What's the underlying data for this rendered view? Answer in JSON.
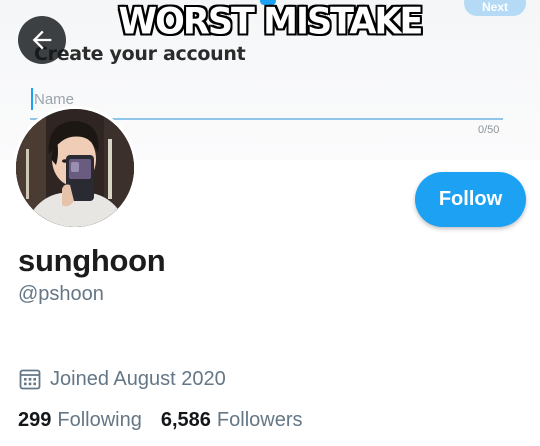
{
  "banner": {
    "caption": "WORST MISTAKE",
    "next_label": "Next",
    "title": "Create your account",
    "name_placeholder": "Name",
    "char_counter": "0/50"
  },
  "profile": {
    "display_name": "sunghoon",
    "handle": "@pshoon",
    "joined": "Joined August 2020",
    "follow_label": "Follow"
  },
  "stats": {
    "following_count": "299",
    "following_label": "Following",
    "followers_count": "6,586",
    "followers_label": "Followers"
  },
  "icons": {
    "back": "arrow-left-icon",
    "calendar": "calendar-icon"
  },
  "colors": {
    "accent": "#1da1f2",
    "secondary_text": "#657786",
    "primary_text": "#14171a"
  }
}
